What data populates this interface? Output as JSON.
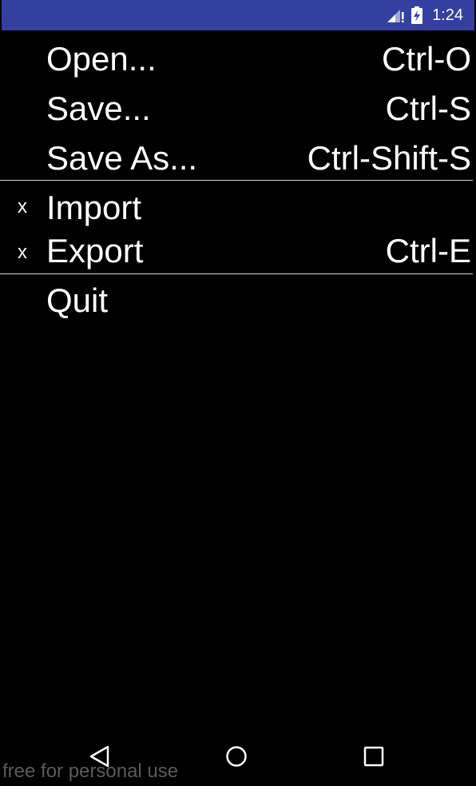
{
  "status_bar": {
    "time": "1:24",
    "signal_icon": "signal-no-data-icon",
    "battery_icon": "battery-charging-icon",
    "color": "#3440a0"
  },
  "menu": {
    "items": [
      {
        "label": "Open...",
        "shortcut": "Ctrl-O",
        "check": ""
      },
      {
        "label": "Save...",
        "shortcut": "Ctrl-S",
        "check": ""
      },
      {
        "label": "Save As...",
        "shortcut": "Ctrl-Shift-S",
        "check": ""
      },
      {
        "label": "Import",
        "shortcut": "",
        "check": "x"
      },
      {
        "label": "Export",
        "shortcut": "Ctrl-E",
        "check": "x"
      },
      {
        "label": "Quit",
        "shortcut": "",
        "check": ""
      }
    ]
  },
  "nav_bar": {
    "back_icon": "back-triangle-icon",
    "home_icon": "home-circle-icon",
    "recent_icon": "recent-apps-square-icon"
  },
  "watermark": {
    "text": "free for personal use"
  }
}
